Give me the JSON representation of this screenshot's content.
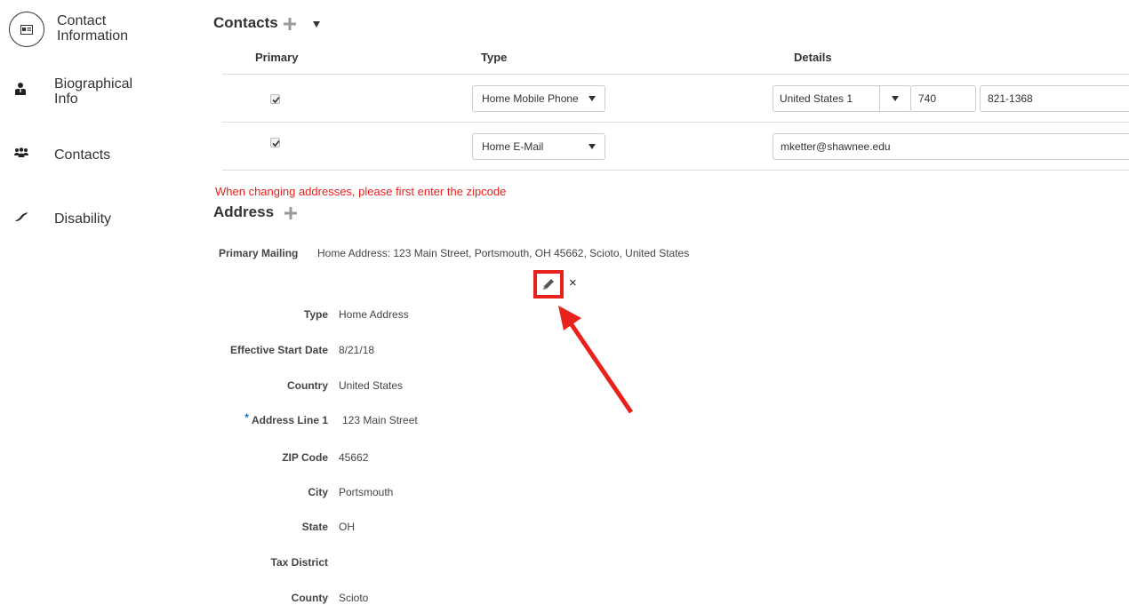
{
  "sidebar": {
    "items": [
      {
        "label_line1": "Contact",
        "label_line2": "Information",
        "icon": "id-card-icon",
        "active": true
      },
      {
        "label_line1": "Biographical",
        "label_line2": "Info",
        "icon": "person-icon"
      },
      {
        "label": "Contacts",
        "icon": "people-group-icon"
      },
      {
        "label": "Disability",
        "icon": "disability-icon"
      }
    ]
  },
  "contacts": {
    "title": "Contacts",
    "headers": {
      "primary": "Primary",
      "type": "Type",
      "details": "Details"
    },
    "rows": [
      {
        "primary": true,
        "type": "Home Mobile Phone",
        "country": "United States 1",
        "area_code": "740",
        "number": "821-1368"
      },
      {
        "primary": true,
        "type": "Home E-Mail",
        "email": "mketter@shawnee.edu"
      }
    ]
  },
  "warning": "When changing addresses, please first enter the zipcode",
  "address": {
    "title": "Address",
    "primary_label": "Primary Mailing",
    "primary_value": "Home Address: 123 Main Street, Portsmouth, OH 45662, Scioto, United States",
    "close_glyph": "×",
    "required_star": "*",
    "fields": {
      "type": {
        "label": "Type",
        "value": "Home Address"
      },
      "start_date": {
        "label": "Effective Start Date",
        "value": "8/21/18"
      },
      "country": {
        "label": "Country",
        "value": "United States"
      },
      "line1": {
        "label": "Address Line 1",
        "value": "123 Main Street"
      },
      "zip": {
        "label": "ZIP Code",
        "value": "45662"
      },
      "city": {
        "label": "City",
        "value": "Portsmouth"
      },
      "state": {
        "label": "State",
        "value": "OH"
      },
      "tax": {
        "label": "Tax District",
        "value": ""
      },
      "county": {
        "label": "County",
        "value": "Scioto"
      }
    }
  },
  "colors": {
    "accent_red": "#e8211c",
    "required_blue": "#1a6fb5",
    "plus_gray": "#999999"
  }
}
